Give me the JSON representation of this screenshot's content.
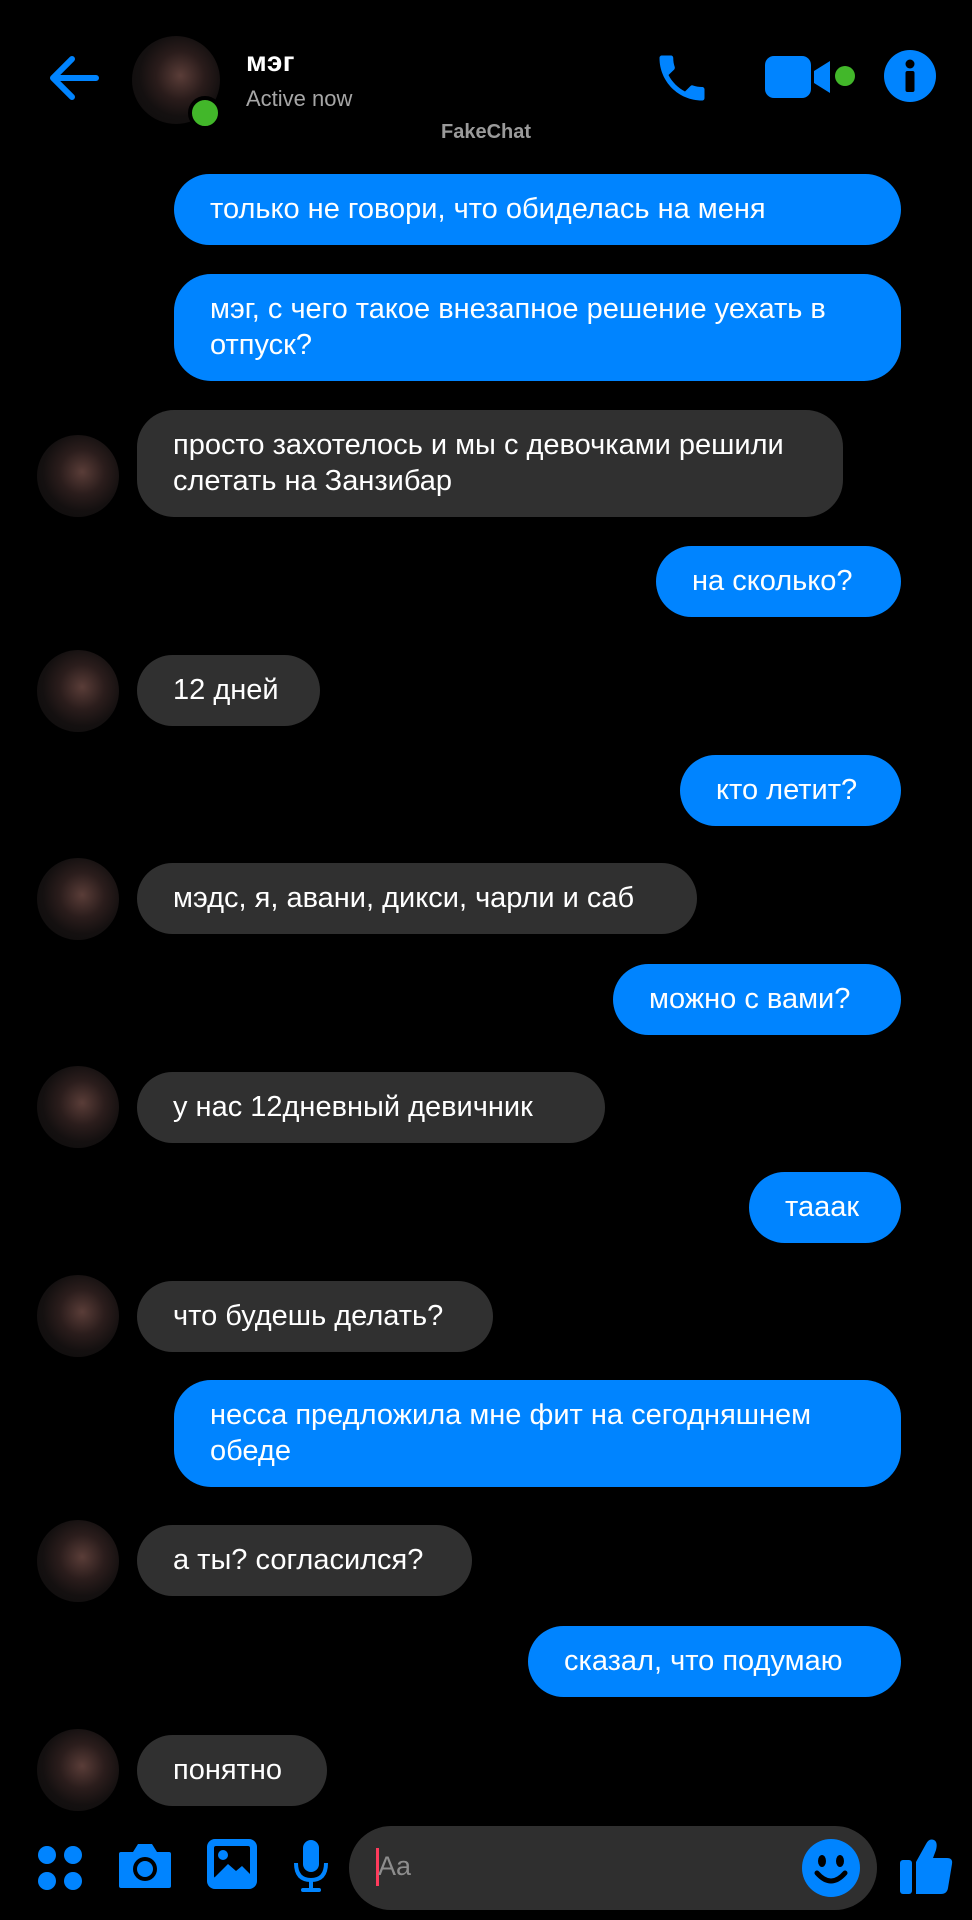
{
  "header": {
    "contact_name": "мэг",
    "status": "Active now",
    "watermark": "FakeChat",
    "icons": {
      "back": "arrow-left-icon",
      "call": "phone-icon",
      "video": "video-camera-icon",
      "info": "info-icon"
    }
  },
  "messages": [
    {
      "from": "me",
      "text": "только не говори, что обиделась на меня"
    },
    {
      "from": "me",
      "text": "мэг, с чего такое внезапное решение уехать в отпуск?"
    },
    {
      "from": "them",
      "text": "просто захотелось и мы с девочками решили слетать на Занзибар"
    },
    {
      "from": "me",
      "text": "на сколько?"
    },
    {
      "from": "them",
      "text": "12 дней"
    },
    {
      "from": "me",
      "text": "кто летит?"
    },
    {
      "from": "them",
      "text": "мэдс, я, авани, дикси, чарли и саб"
    },
    {
      "from": "me",
      "text": "можно с вами?"
    },
    {
      "from": "them",
      "text": "у нас 12дневный девичник"
    },
    {
      "from": "me",
      "text": "тааак"
    },
    {
      "from": "them",
      "text": "что будешь делать?"
    },
    {
      "from": "me",
      "text": "несса предложила мне фит на сегодняшнем обеде"
    },
    {
      "from": "them",
      "text": "а ты? согласился?"
    },
    {
      "from": "me",
      "text": "сказал, что подумаю"
    },
    {
      "from": "them",
      "text": "понятно"
    }
  ],
  "composer": {
    "placeholder": "Aa",
    "icons": [
      "apps-grid-icon",
      "camera-icon",
      "gallery-icon",
      "microphone-icon",
      "emoji-icon",
      "thumbs-up-icon"
    ]
  },
  "colors": {
    "accent": "#0084ff",
    "sent_bubble": "#0084ff",
    "received_bubble": "#303030",
    "online": "#42b72a",
    "background": "#000000"
  }
}
